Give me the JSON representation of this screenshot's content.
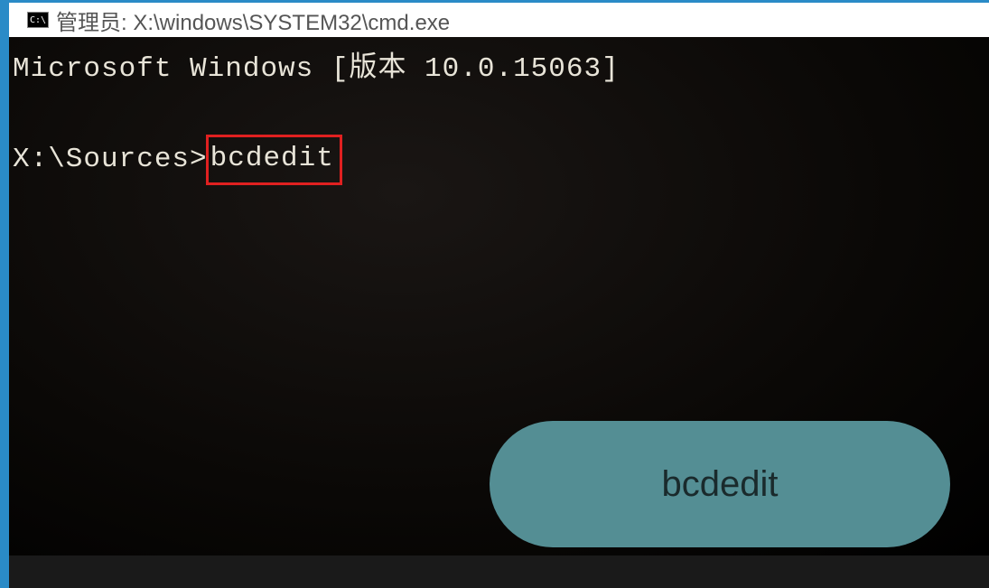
{
  "window": {
    "icon_text": "C:\\",
    "title": "管理员: X:\\windows\\SYSTEM32\\cmd.exe"
  },
  "terminal": {
    "version_line": "Microsoft Windows [版本 10.0.15063]",
    "prompt": "X:\\Sources>",
    "command": "bcdedit"
  },
  "callout": {
    "label": "bcdedit"
  }
}
